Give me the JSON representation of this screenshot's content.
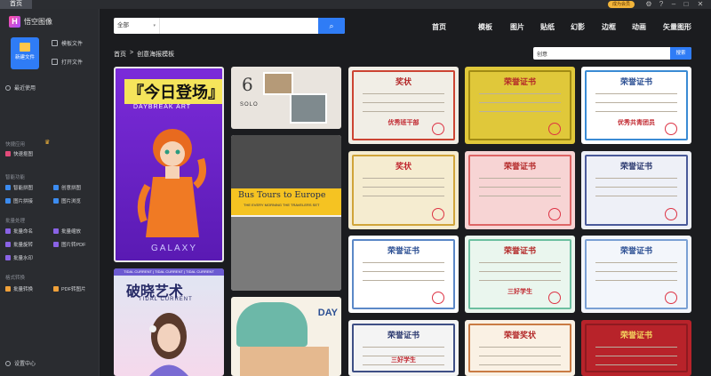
{
  "titlebar": {
    "tab": "首页",
    "vip_label": "成为会员"
  },
  "app": {
    "name": "悟空图像",
    "logo": "H"
  },
  "sidebar": {
    "new_file": "新建文件",
    "template_file": "模板文件",
    "open_file": "打开文件",
    "recent": "最近使用",
    "quick_section": "快捷应用",
    "quick_items": [
      "快速抠图"
    ],
    "smart_section": "智能功能",
    "smart_items": [
      "智能拼图",
      "创意拼图",
      "图片拼接",
      "图片浏览"
    ],
    "batch_section": "批量处理",
    "batch_items": [
      "批量命名",
      "批量缩放",
      "批量旋转",
      "图片转PDF",
      "批量水印"
    ],
    "format_section": "格式转换",
    "format_items": [
      "批量转换",
      "PDF转图片"
    ],
    "settings": "设置中心"
  },
  "search": {
    "category": "全部",
    "placeholder": "",
    "button_icon": "search-icon"
  },
  "topnav": [
    "首页",
    "模板",
    "图片",
    "贴纸",
    "幻影",
    "边框",
    "动画",
    "矢量图形"
  ],
  "breadcrumb": {
    "home": "首页",
    "sep": ">",
    "current": "创意海报模板"
  },
  "subsearch": {
    "value": "创意",
    "button": "搜索"
  },
  "posters": {
    "p1_title": "『今日登场』",
    "p1_sub": "DAYBREAK ART",
    "p1_foot": "GALAXY",
    "p2_top": "TIDAL CURRENT | TIDAL CURRENT | TIDAL CURRENT",
    "p2_title": "破晓艺术",
    "p2_sub": "TIDAL CURRENT",
    "bus_title": "Bus Tours to Europe",
    "bus_sub": "THE EVERY MORNING THE TRAVELERS SET",
    "day_text": "DAY",
    "collage_num": "6",
    "collage_solo": "SOLO"
  },
  "certs": [
    {
      "title": "奖状",
      "sub": "优秀班干部",
      "color": "#b32828"
    },
    {
      "title": "荣誉证书",
      "sub": "",
      "color": "#b32828"
    },
    {
      "title": "荣誉证书",
      "sub": "优秀共青团员",
      "color": "#2c4f93"
    },
    {
      "title": "奖状",
      "sub": "",
      "color": "#c0262e"
    },
    {
      "title": "荣誉证书",
      "sub": "",
      "color": "#b32828"
    },
    {
      "title": "荣誉证书",
      "sub": "",
      "color": "#2c3a70"
    },
    {
      "title": "荣誉证书",
      "sub": "",
      "color": "#2c4f93"
    },
    {
      "title": "荣誉证书",
      "sub": "三好学生",
      "color": "#b32828"
    },
    {
      "title": "荣誉证书",
      "sub": "",
      "color": "#2c4f93"
    },
    {
      "title": "荣誉证书",
      "sub": "三好学生",
      "color": "#2c3a70"
    },
    {
      "title": "荣誉奖状",
      "sub": "",
      "color": "#b32828"
    },
    {
      "title": "荣誉证书",
      "sub": "",
      "color": "#f4d35e"
    }
  ],
  "colors": {
    "accent": "#2f7cf6",
    "bg": "#1b1c1f",
    "sidebar": "#2a2c30"
  }
}
